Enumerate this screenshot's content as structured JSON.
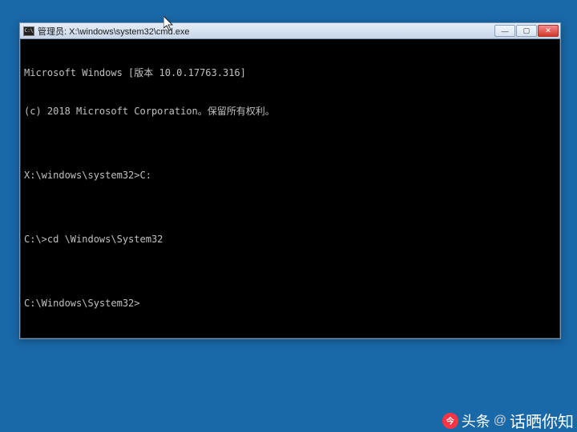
{
  "window": {
    "icon_text": "C:\\",
    "title": "管理员: X:\\windows\\system32\\cmd.exe",
    "controls": {
      "minimize": "—",
      "maximize": "▢",
      "close": "✕"
    }
  },
  "console": {
    "lines": [
      "Microsoft Windows [版本 10.0.17763.316]",
      "(c) 2018 Microsoft Corporation。保留所有权利。",
      "",
      "X:\\windows\\system32>C:",
      "",
      "C:\\>cd \\Windows\\System32",
      "",
      "C:\\Windows\\System32>"
    ]
  },
  "watermark": {
    "brand": "头条",
    "at": "@",
    "name": "话晒你知"
  }
}
